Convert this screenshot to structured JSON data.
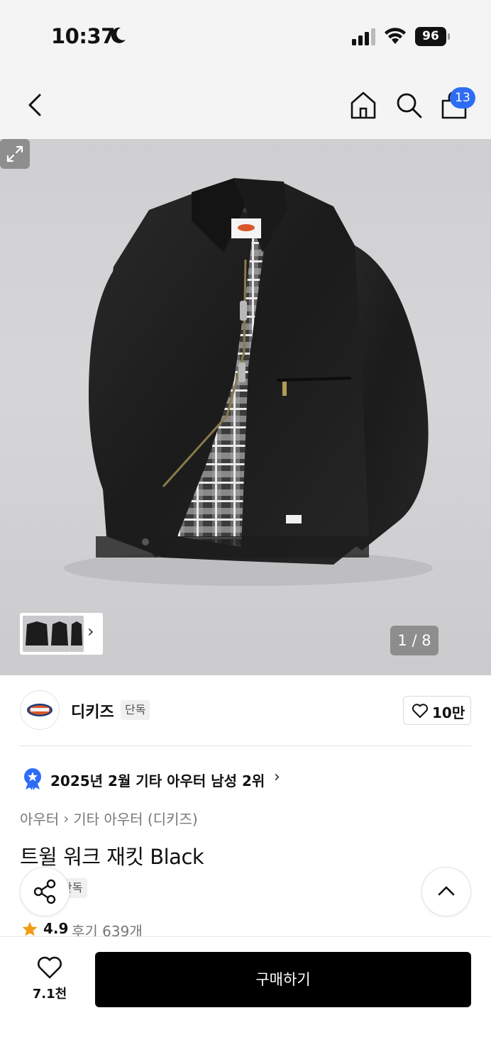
{
  "status_bar": {
    "time": "10:37",
    "battery": "96"
  },
  "header": {
    "cart_count": "13"
  },
  "gallery": {
    "counter": "1 / 8"
  },
  "brand": {
    "name": "디키즈",
    "badge": "단독",
    "like_count": "10만"
  },
  "ranking": {
    "text": "2025년 2월 기타 아우터 남성 2위"
  },
  "breadcrumb": {
    "items": [
      "아우터",
      "기타 아우터 (디키즈)"
    ]
  },
  "product": {
    "title": "트윌 워크 재킷 Black",
    "tag": "단독",
    "rating": "4.9",
    "reviews": "후기 639개"
  },
  "bottom_bar": {
    "wish_count": "7.1천",
    "buy_label": "구매하기"
  },
  "colors": {
    "accent_blue": "#2e6cf6",
    "star_orange": "#f29b12",
    "buy_black": "#000000"
  }
}
